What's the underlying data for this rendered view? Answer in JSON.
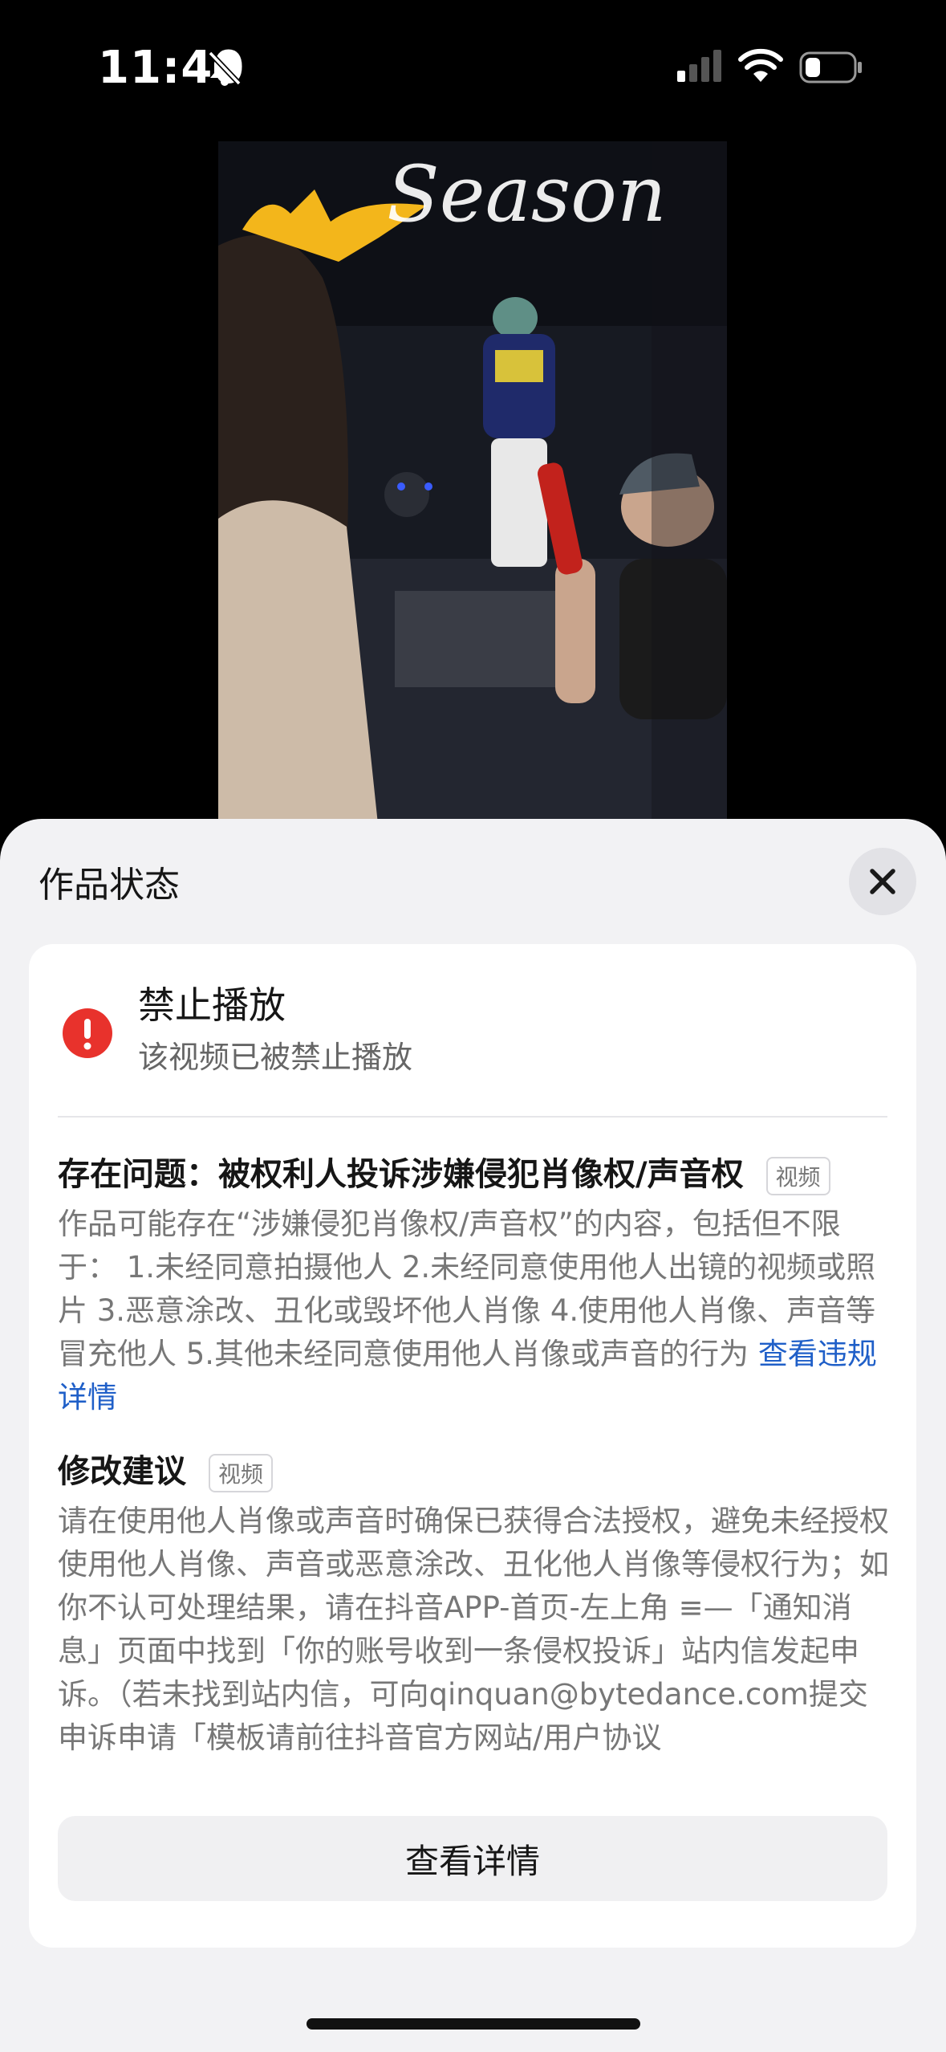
{
  "status_bar": {
    "time": "11:40"
  },
  "video": {
    "banner_text": "Season"
  },
  "sheet": {
    "title": "作品状态",
    "status": {
      "title": "禁止播放",
      "subtitle": "该视频已被禁止播放"
    },
    "issue": {
      "heading": "存在问题：被权利人投诉涉嫌侵犯肖像权/声音权",
      "tag": "视频",
      "description": "作品可能存在“涉嫌侵犯肖像权/声音权”的内容，包括但不限于： 1.未经同意拍摄他人 2.未经同意使用他人出镜的视频或照片 3.恶意涂改、丑化或毁坏他人肖像 4.使用他人肖像、声音等冒充他人 5.其他未经同意使用他人肖像或声音的行为",
      "link": "查看违规详情"
    },
    "suggestion": {
      "heading": "修改建议",
      "tag": "视频",
      "description": "请在使用他人肖像或声音时确保已获得合法授权，避免未经授权使用他人肖像、声音或恶意涂改、丑化他人肖像等侵权行为；如你不认可处理结果，请在抖音APP-首页-左上角 ≡—「通知消息」页面中找到「你的账号收到一条侵权投诉」站内信发起申诉。（若未找到站内信，可向qinquan@bytedance.com提交申诉申请「模板请前往抖音官方网站/用户协议"
    },
    "detail_button": "查看详情"
  },
  "colors": {
    "alert": "#e8322c",
    "link": "#1f5fc8",
    "sheet_bg": "#f2f2f4"
  },
  "icons": [
    "bell-slash-icon",
    "signal-icon",
    "wifi-icon",
    "battery-icon",
    "close-icon",
    "alert-icon"
  ]
}
